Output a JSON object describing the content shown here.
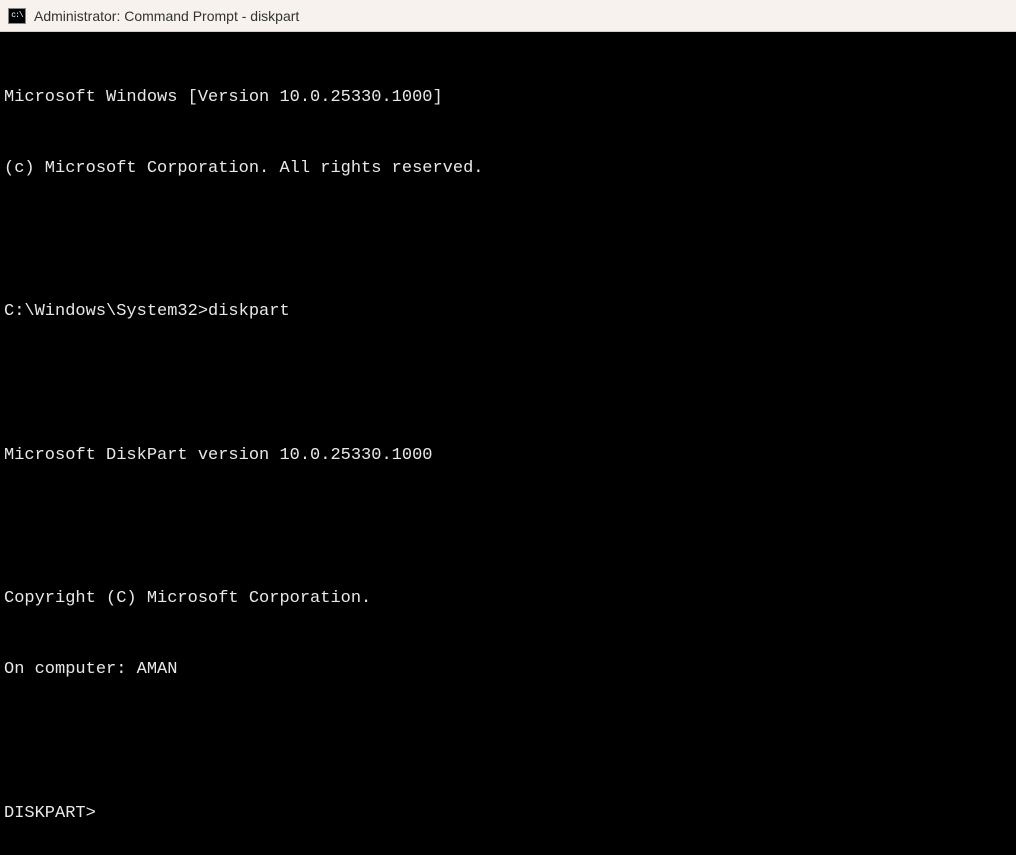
{
  "title_bar": {
    "icon_label": "C:\\",
    "title": "Administrator: Command Prompt - diskpart"
  },
  "terminal": {
    "lines": [
      "Microsoft Windows [Version 10.0.25330.1000]",
      "(c) Microsoft Corporation. All rights reserved.",
      "",
      "C:\\Windows\\System32>diskpart",
      "",
      "Microsoft DiskPart version 10.0.25330.1000",
      "",
      "Copyright (C) Microsoft Corporation.",
      "On computer: AMAN",
      "",
      "DISKPART>"
    ]
  }
}
